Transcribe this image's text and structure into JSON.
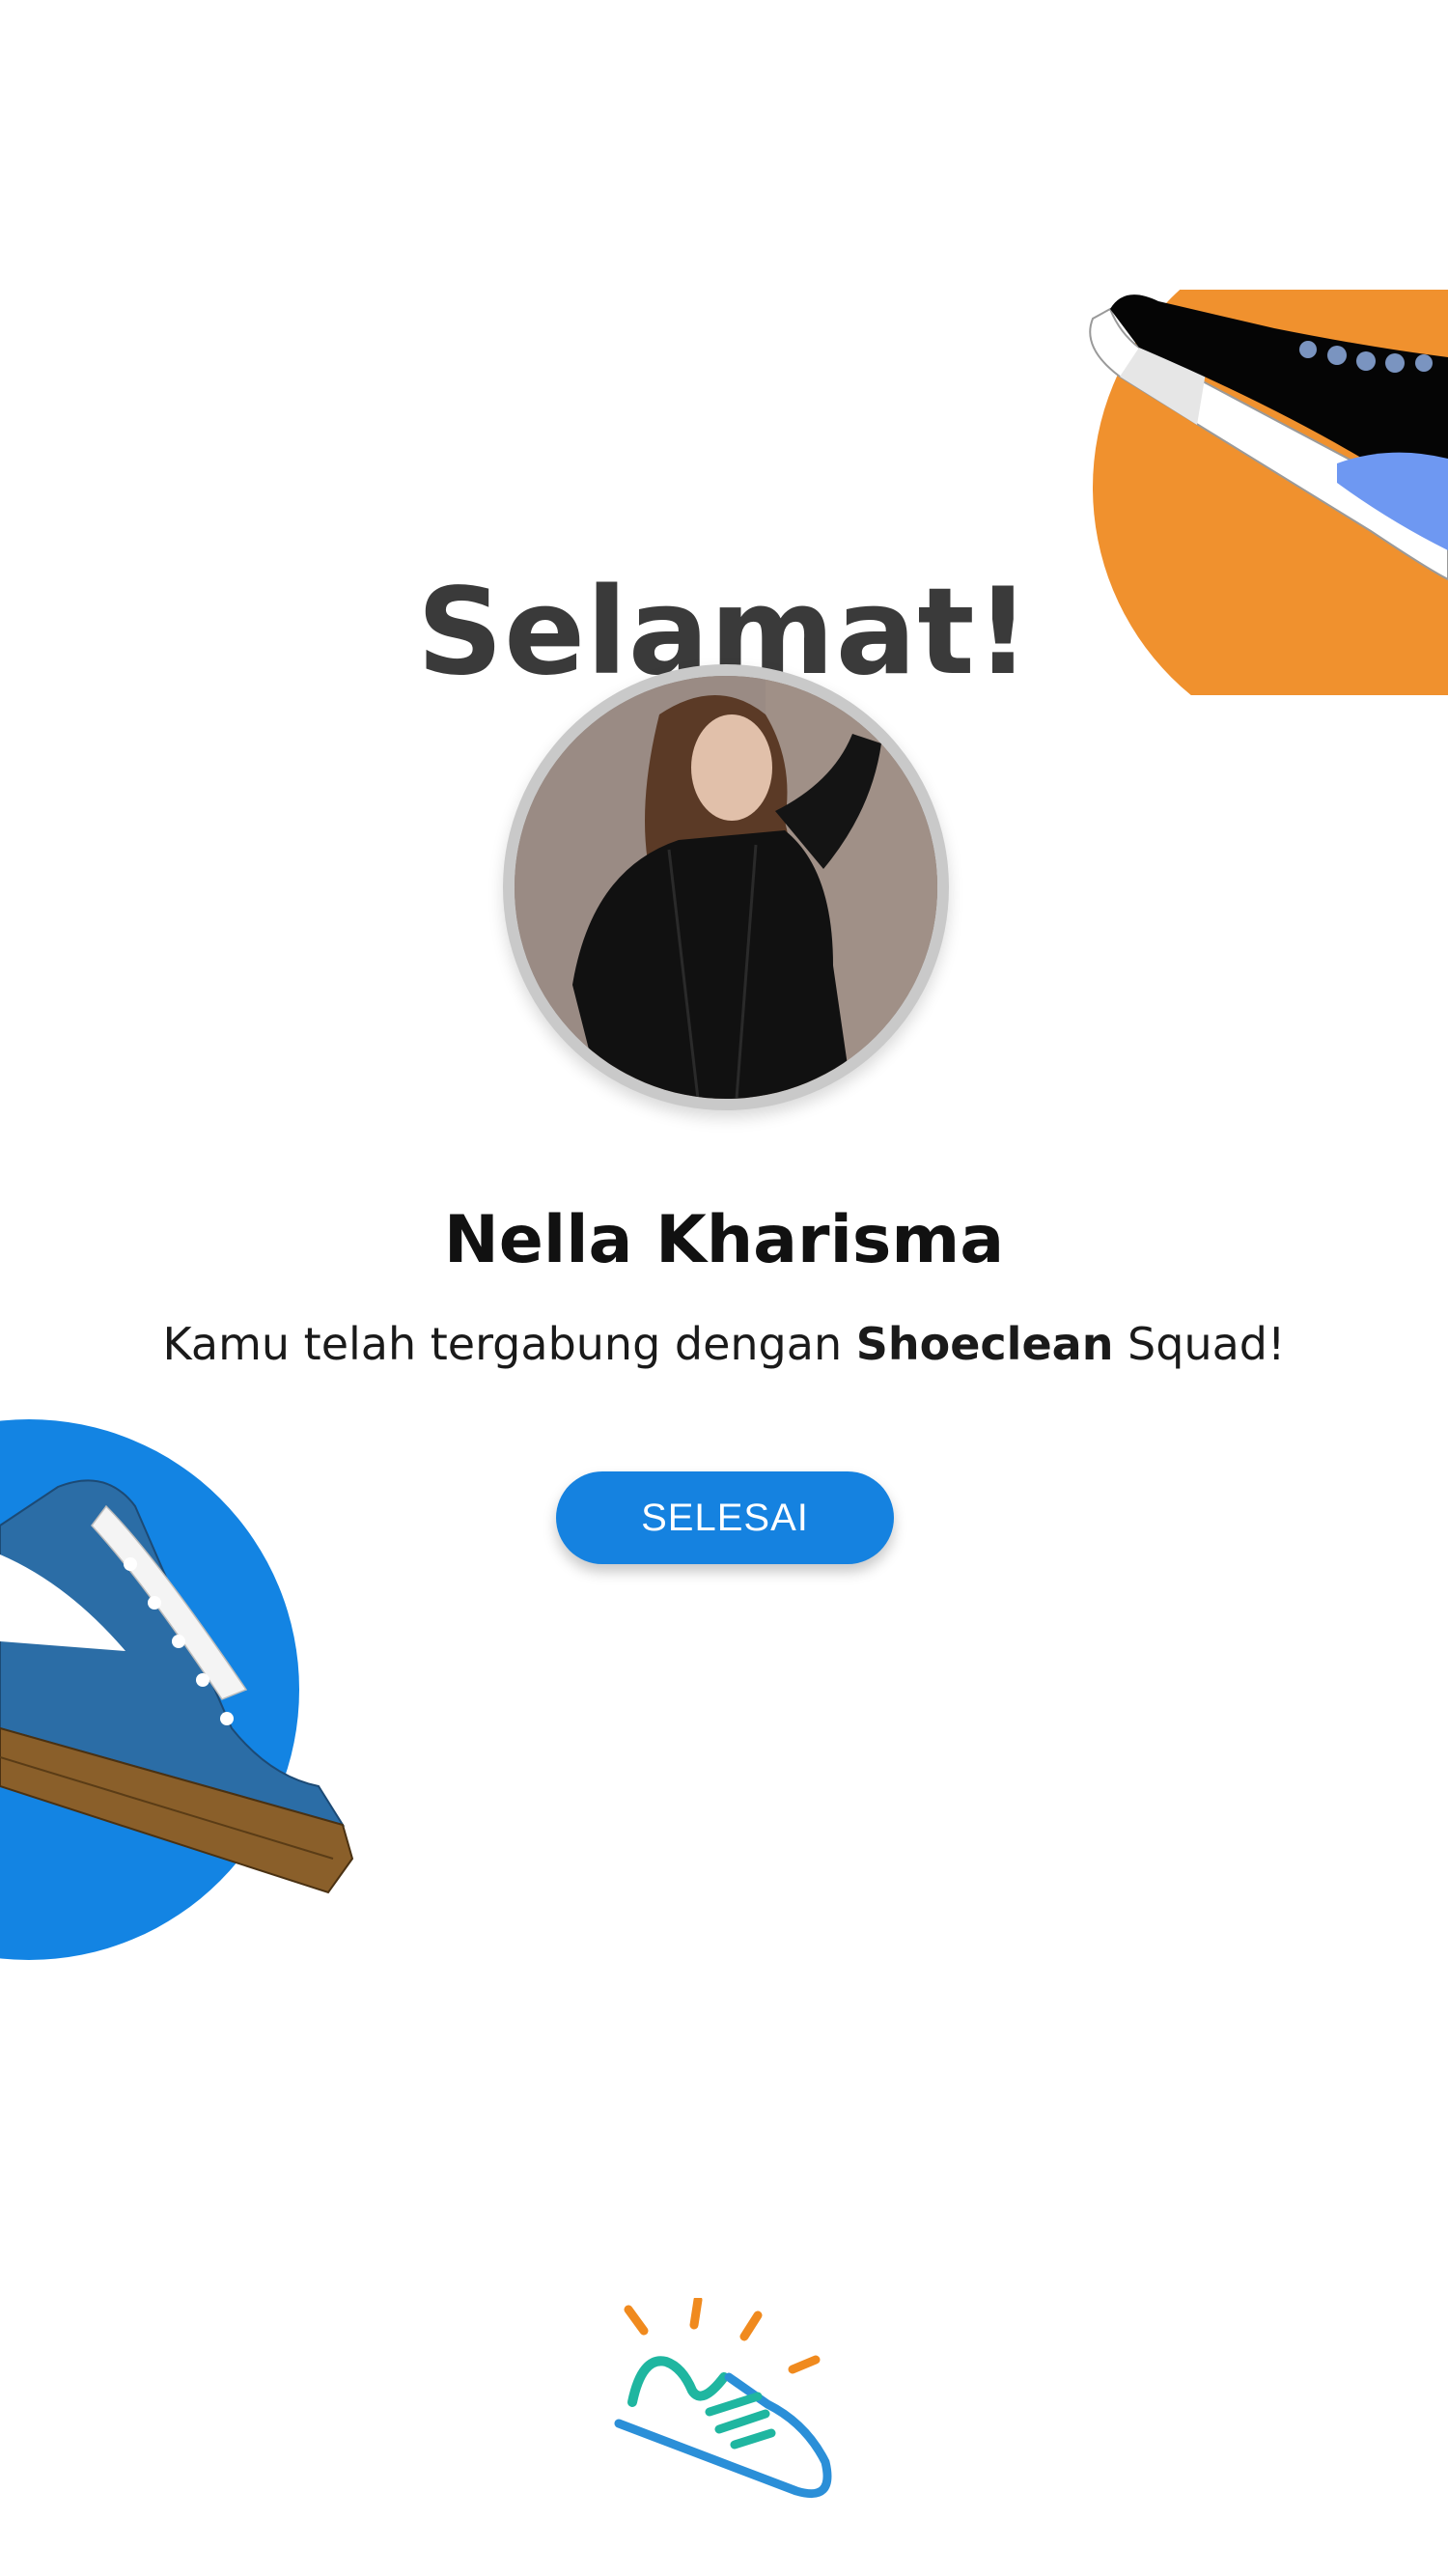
{
  "title": "Selamat!",
  "profile": {
    "name": "Nella Kharisma",
    "avatar_icon": "profile-photo"
  },
  "message": {
    "prefix": "Kamu telah tergabung dengan ",
    "brand": "Shoeclean",
    "suffix": " Squad!"
  },
  "actions": {
    "done_label": "SELESAI"
  },
  "decorations": {
    "top_right": "sneaker-illustration-orange-circle",
    "left": "sneaker-illustration-blue-circle",
    "logo": "shoeclean-logo-icon"
  },
  "colors": {
    "primary": "#1582e0",
    "accent_orange": "#f0912e",
    "accent_blue": "#1384e3",
    "title_text": "#3a3a3a",
    "logo_teal": "#1fb6a0",
    "logo_blue": "#2b8fd8",
    "logo_orange": "#f08a1e"
  }
}
